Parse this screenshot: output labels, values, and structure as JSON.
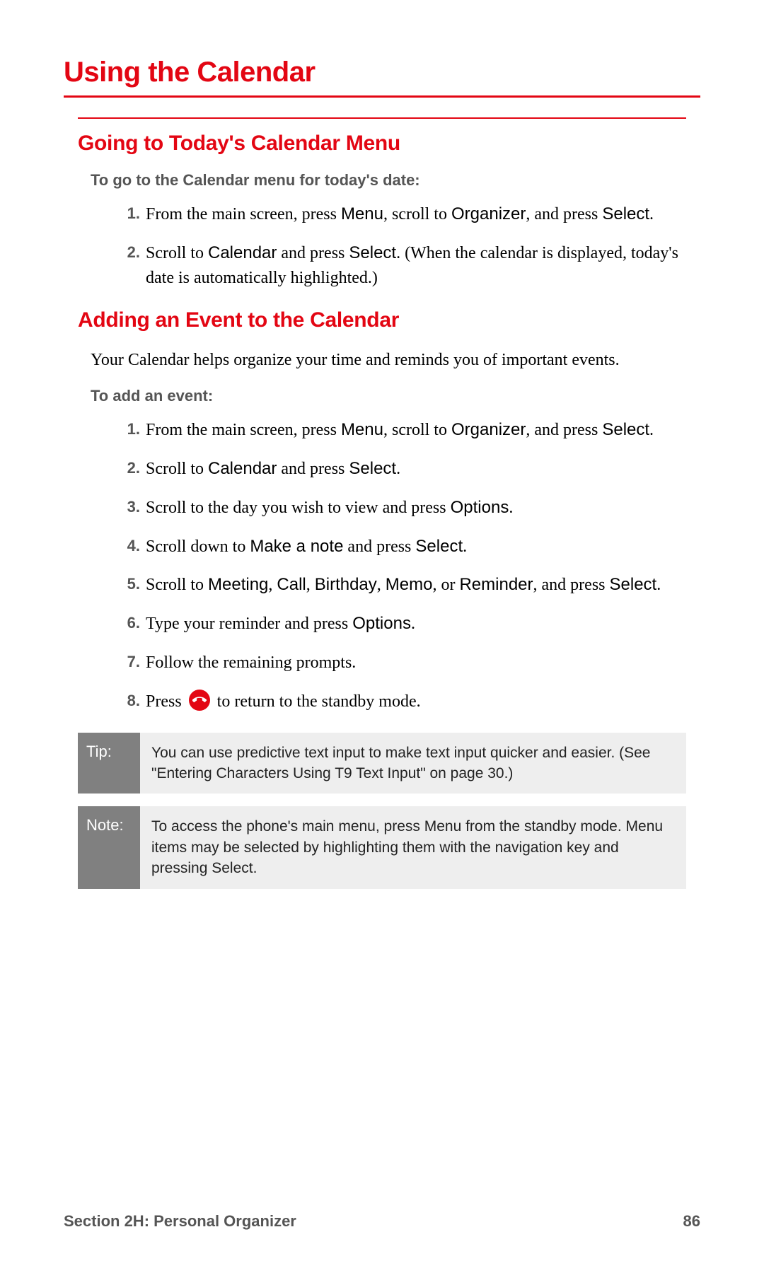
{
  "title": "Using the Calendar",
  "section1": {
    "heading": "Going to Today's Calendar Menu",
    "intro": "To go to the Calendar menu for today's date:",
    "steps": [
      {
        "pre": "From the main screen, press ",
        "k1": "Menu",
        "mid1": ", scroll to ",
        "k2": "Organizer",
        "mid2": ", and press ",
        "k3": "Select",
        "post": "."
      },
      {
        "pre": "Scroll to ",
        "k1": "Calendar",
        "mid1": " and press ",
        "k2": "Select",
        "post": ". (When the calendar is displayed, today's date is automatically highlighted.)"
      }
    ]
  },
  "section2": {
    "heading": "Adding an Event to the Calendar",
    "para": "Your Calendar helps organize your time and reminds you of important events.",
    "intro": "To add an event:",
    "steps": [
      {
        "pre": "From the main screen, press ",
        "k1": "Menu",
        "mid1": ", scroll to ",
        "k2": "Organizer",
        "mid2": ", and press ",
        "k3": "Select",
        "post": "."
      },
      {
        "pre": "Scroll to ",
        "k1": "Calendar",
        "mid1": " and press ",
        "k2": "Select",
        "post": "."
      },
      {
        "pre": "Scroll to the day you wish to view and press ",
        "k1": "Options",
        "post": "."
      },
      {
        "pre": "Scroll down to ",
        "k1": "Make a note",
        "mid1": " and press ",
        "k2": "Select",
        "post": "."
      },
      {
        "pre": "Scroll to ",
        "k1": "Meeting",
        "mid1": ", ",
        "k2": "Call",
        "mid2": ", ",
        "k3": "Birthday",
        "mid3": ", ",
        "k4": "Memo",
        "mid4": ", or ",
        "k5": "Reminder",
        "mid5": ", and press ",
        "k6": "Select",
        "post": "."
      },
      {
        "pre": "Type your reminder and press ",
        "k1": "Options",
        "post": "."
      },
      {
        "pre": "Follow the remaining prompts."
      },
      {
        "pre": "Press ",
        "icon": true,
        "post": " to return to the standby mode."
      }
    ]
  },
  "tip": {
    "label": "Tip:",
    "body": "You can use predictive text input to make text input quicker and easier. (See \"Entering Characters Using T9 Text Input\" on page 30.)"
  },
  "note": {
    "label": "Note:",
    "pre": "To access the phone's main menu, press ",
    "k1": "Menu",
    "mid1": " from the standby mode. Menu items may be selected by highlighting them with the navigation key and pressing ",
    "k2": "Select",
    "post": "."
  },
  "footer": {
    "section": "Section 2H: Personal Organizer",
    "page": "86"
  }
}
